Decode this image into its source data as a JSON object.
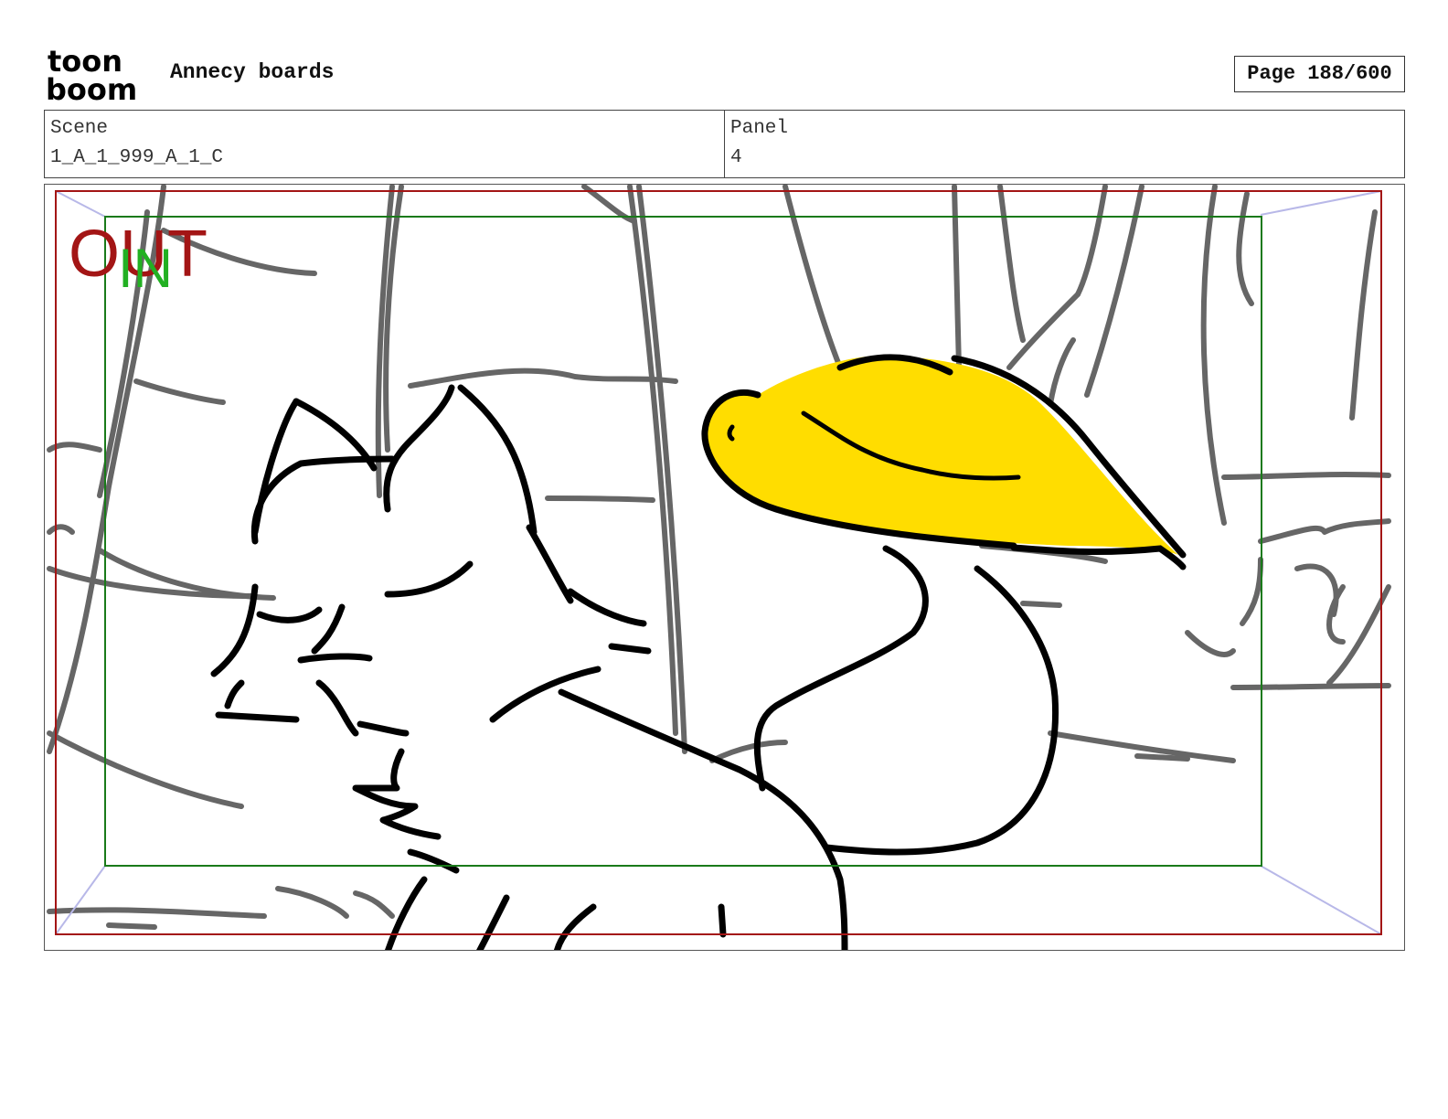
{
  "header": {
    "logo_line1": "toon",
    "logo_line2": "boom",
    "project_title": "Annecy boards",
    "page_indicator": "Page 188/600"
  },
  "info": {
    "scene_label": "Scene",
    "scene_value": "1_A_1_999_A_1_C",
    "panel_label": "Panel",
    "panel_value": "4"
  },
  "panel": {
    "out_label": "OUT",
    "in_label": "IN",
    "colors": {
      "out_frame": "#a31515",
      "in_frame": "#1a7a1a",
      "in_text": "#22b022",
      "hat_fill": "#ffdd00",
      "ink": "#000000",
      "background_ink": "#666666",
      "perspective": "#b8b8e8"
    }
  }
}
